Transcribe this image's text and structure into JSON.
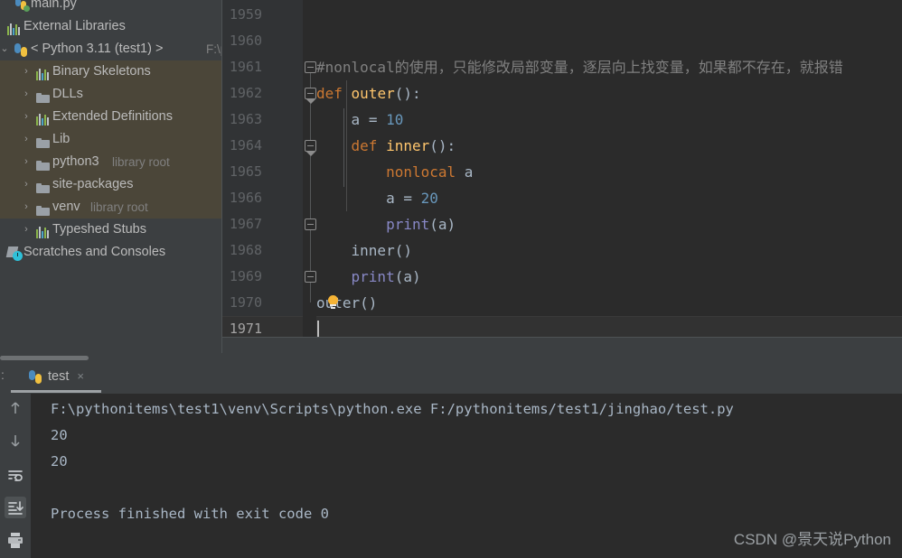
{
  "project_tree": {
    "items": [
      {
        "label": "main.py",
        "icon": "python-file-icon",
        "indent": 34,
        "arrow": "",
        "sub": "",
        "selected": false,
        "partial_top": true
      },
      {
        "label": "External Libraries",
        "icon": "library-bars-icon",
        "indent": 26,
        "arrow": "",
        "sub": "",
        "selected": false
      },
      {
        "label": "< Python 3.11 (test1) >",
        "icon": "python-interpreter-icon",
        "indent": 34,
        "arrow": "v",
        "sub": "F:\\py",
        "selected": false
      },
      {
        "label": "Binary Skeletons",
        "icon": "library-bars-icon",
        "indent": 58,
        "arrow": ">",
        "sub": "",
        "selected": true
      },
      {
        "label": "DLLs",
        "icon": "folder-icon",
        "indent": 58,
        "arrow": ">",
        "sub": "",
        "selected": true
      },
      {
        "label": "Extended Definitions",
        "icon": "library-bars-icon",
        "indent": 58,
        "arrow": ">",
        "sub": "",
        "selected": true
      },
      {
        "label": "Lib",
        "icon": "folder-icon",
        "indent": 58,
        "arrow": ">",
        "sub": "",
        "selected": true
      },
      {
        "label": "python3",
        "icon": "folder-icon",
        "indent": 58,
        "arrow": ">",
        "sub": "library root",
        "selected": true
      },
      {
        "label": "site-packages",
        "icon": "folder-icon",
        "indent": 58,
        "arrow": ">",
        "sub": "",
        "selected": true
      },
      {
        "label": "venv",
        "icon": "folder-icon",
        "indent": 58,
        "arrow": ">",
        "sub": "library root",
        "selected": true
      },
      {
        "label": "Typeshed Stubs",
        "icon": "library-bars-icon",
        "indent": 58,
        "arrow": ">",
        "sub": "",
        "selected": false
      },
      {
        "label": "Scratches and Consoles",
        "icon": "scratches-icon",
        "indent": 26,
        "arrow": "",
        "sub": "",
        "selected": false
      }
    ]
  },
  "editor": {
    "line_numbers": [
      "1959",
      "1960",
      "1961",
      "1962",
      "1963",
      "1964",
      "1965",
      "1966",
      "1967",
      "1968",
      "1969",
      "1970",
      "1971"
    ],
    "current_line": "1971",
    "lines": [
      {
        "n": "1959",
        "text": ""
      },
      {
        "n": "1960",
        "text": ""
      },
      {
        "n": "1961",
        "text": "#nonlocal的使用，只能修改局部变量，逐层向上找变量，如果都不存在，就报错",
        "kind": "comment"
      },
      {
        "n": "1962",
        "text": "def outer():",
        "kind": "def"
      },
      {
        "n": "1963",
        "text": "    a = 10",
        "kind": "assign"
      },
      {
        "n": "1964",
        "text": "    def inner():",
        "kind": "def"
      },
      {
        "n": "1965",
        "text": "        nonlocal a",
        "kind": "nonlocal"
      },
      {
        "n": "1966",
        "text": "        a = 20",
        "kind": "assign"
      },
      {
        "n": "1967",
        "text": "        print(a)",
        "kind": "call"
      },
      {
        "n": "1968",
        "text": "    inner()",
        "kind": "plaincall"
      },
      {
        "n": "1969",
        "text": "    print(a)",
        "kind": "call"
      },
      {
        "n": "1970",
        "text": "outer()",
        "kind": "plaincall"
      },
      {
        "n": "1971",
        "text": "",
        "kind": "empty"
      }
    ],
    "tokens": {
      "comment_1961": "#nonlocal的使用，只能修改局部变量，逐层向上找变量，如果都不存在，就报错",
      "kw_def": "def",
      "fn_outer": "outer",
      "fn_inner": "inner",
      "kw_nonlocal": "nonlocal",
      "var_a": "a",
      "num_10": "10",
      "num_20": "20",
      "fn_print": "print",
      "call_inner": "inner()",
      "call_outer": "outer()",
      "paren_open": "(",
      "paren_close": ")",
      "colon": ":",
      "equals": "=",
      "paren_a": "(a)",
      "empty_parens": "()"
    },
    "colors": {
      "background": "#2B2B2B",
      "gutter": "#313335",
      "keyword": "#CC7832",
      "function": "#FFC66D",
      "number": "#6897BB",
      "comment": "#808080",
      "builtin": "#8888C6",
      "text": "#A9B7C6"
    }
  },
  "run_panel": {
    "tab_label": "test",
    "tab_icon": "python-icon",
    "tab_close": "×",
    "colon_mark": ":",
    "toolbar_icons": [
      {
        "name": "up-arrow-icon",
        "active": false
      },
      {
        "name": "down-arrow-icon",
        "active": false
      },
      {
        "name": "soft-wrap-icon",
        "active": false
      },
      {
        "name": "scroll-to-end-icon",
        "active": true
      },
      {
        "name": "print-icon",
        "active": false
      }
    ],
    "console_lines": [
      "F:\\pythonitems\\test1\\venv\\Scripts\\python.exe F:/pythonitems/test1/jinghao/test.py",
      "20",
      "20",
      "",
      "Process finished with exit code 0"
    ]
  },
  "watermark": {
    "text": "CSDN @景天说Python"
  }
}
